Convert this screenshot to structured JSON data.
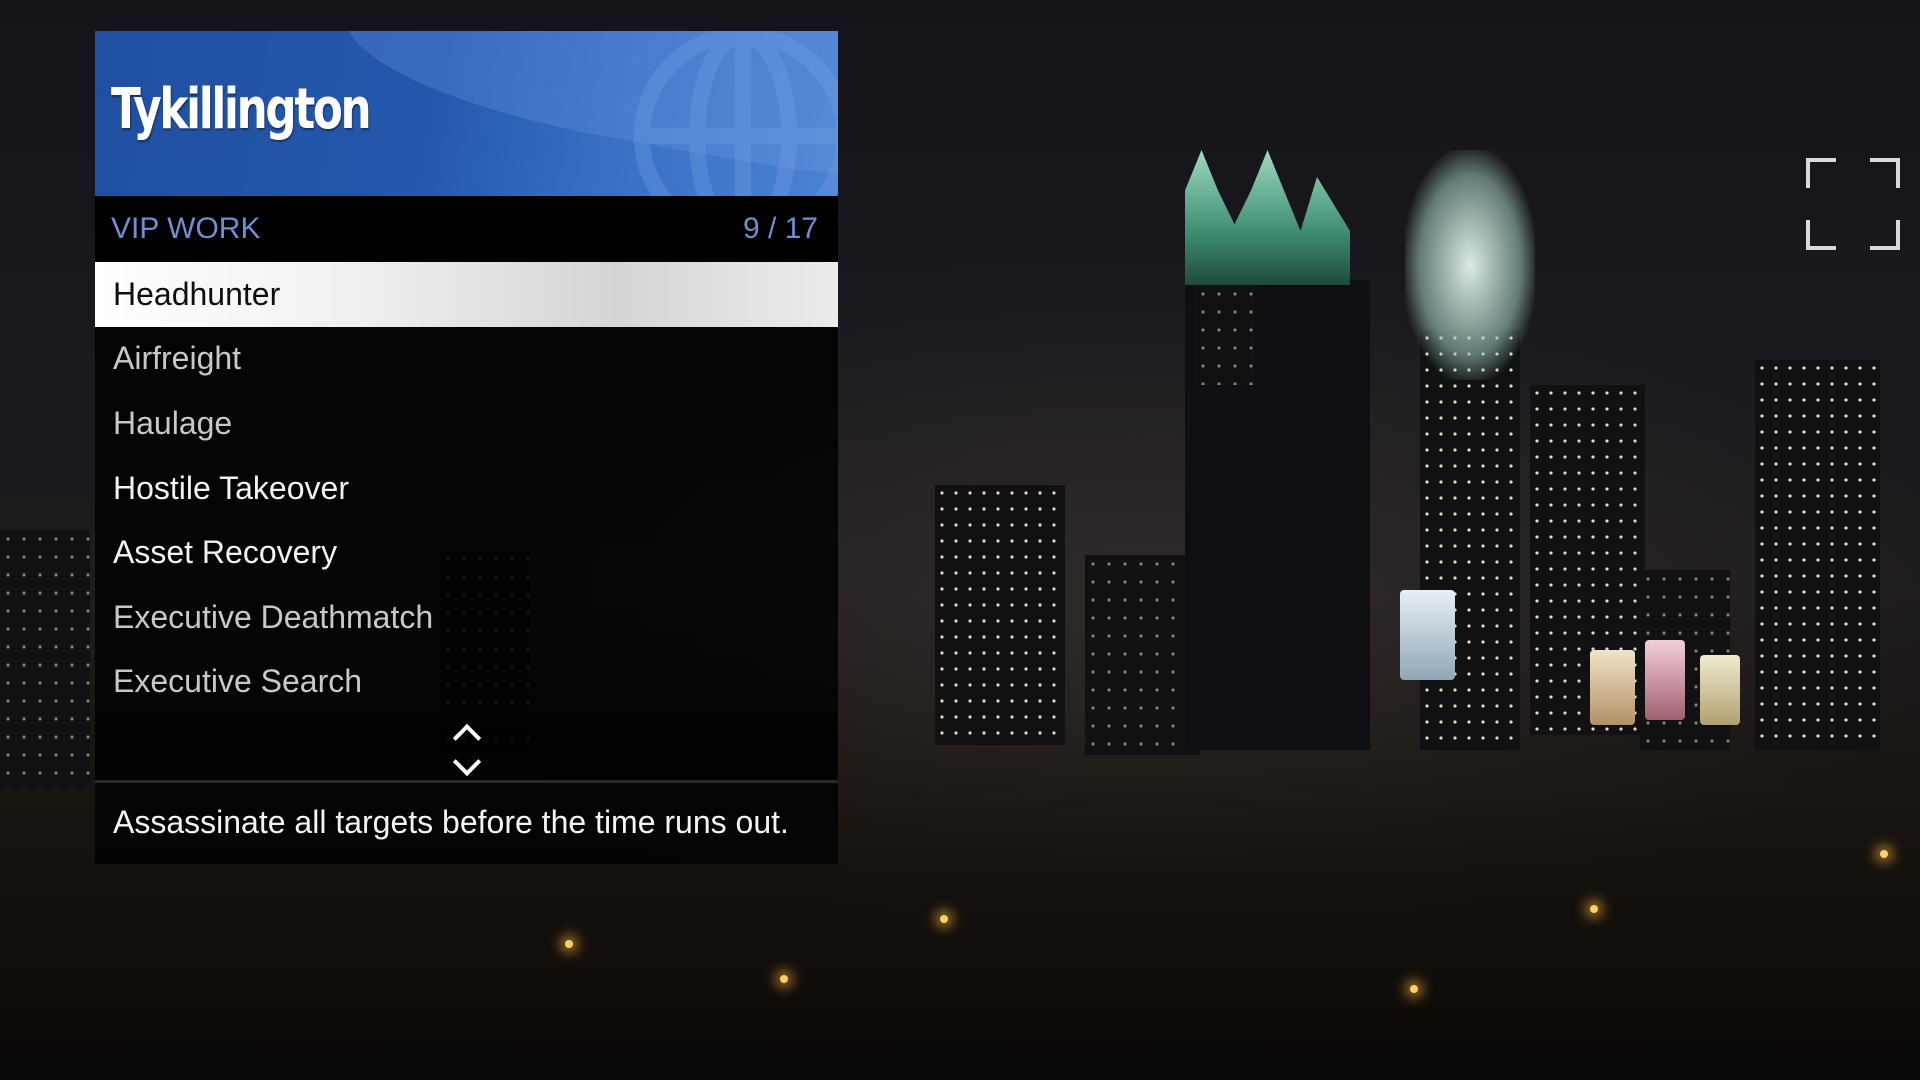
{
  "menu": {
    "title": "Tykillington",
    "category": "VIP WORK",
    "position": "9 / 17",
    "items": [
      {
        "label": "Headhunter",
        "selected": true
      },
      {
        "label": "Airfreight",
        "selected": false
      },
      {
        "label": "Haulage",
        "selected": false
      },
      {
        "label": "Hostile Takeover",
        "selected": false
      },
      {
        "label": "Asset Recovery",
        "selected": false
      },
      {
        "label": "Executive Deathmatch",
        "selected": false
      },
      {
        "label": "Executive Search",
        "selected": false
      }
    ],
    "scroll_icon": "up-down-chevrons-icon",
    "description": "Assassinate all targets before the time runs out."
  },
  "overlay": {
    "fullscreen_icon": "fullscreen-brackets-icon"
  },
  "colors": {
    "header_blue": "#2558ad",
    "category_text": "#6f8fcf",
    "selected_row": "#f0f0f0"
  }
}
